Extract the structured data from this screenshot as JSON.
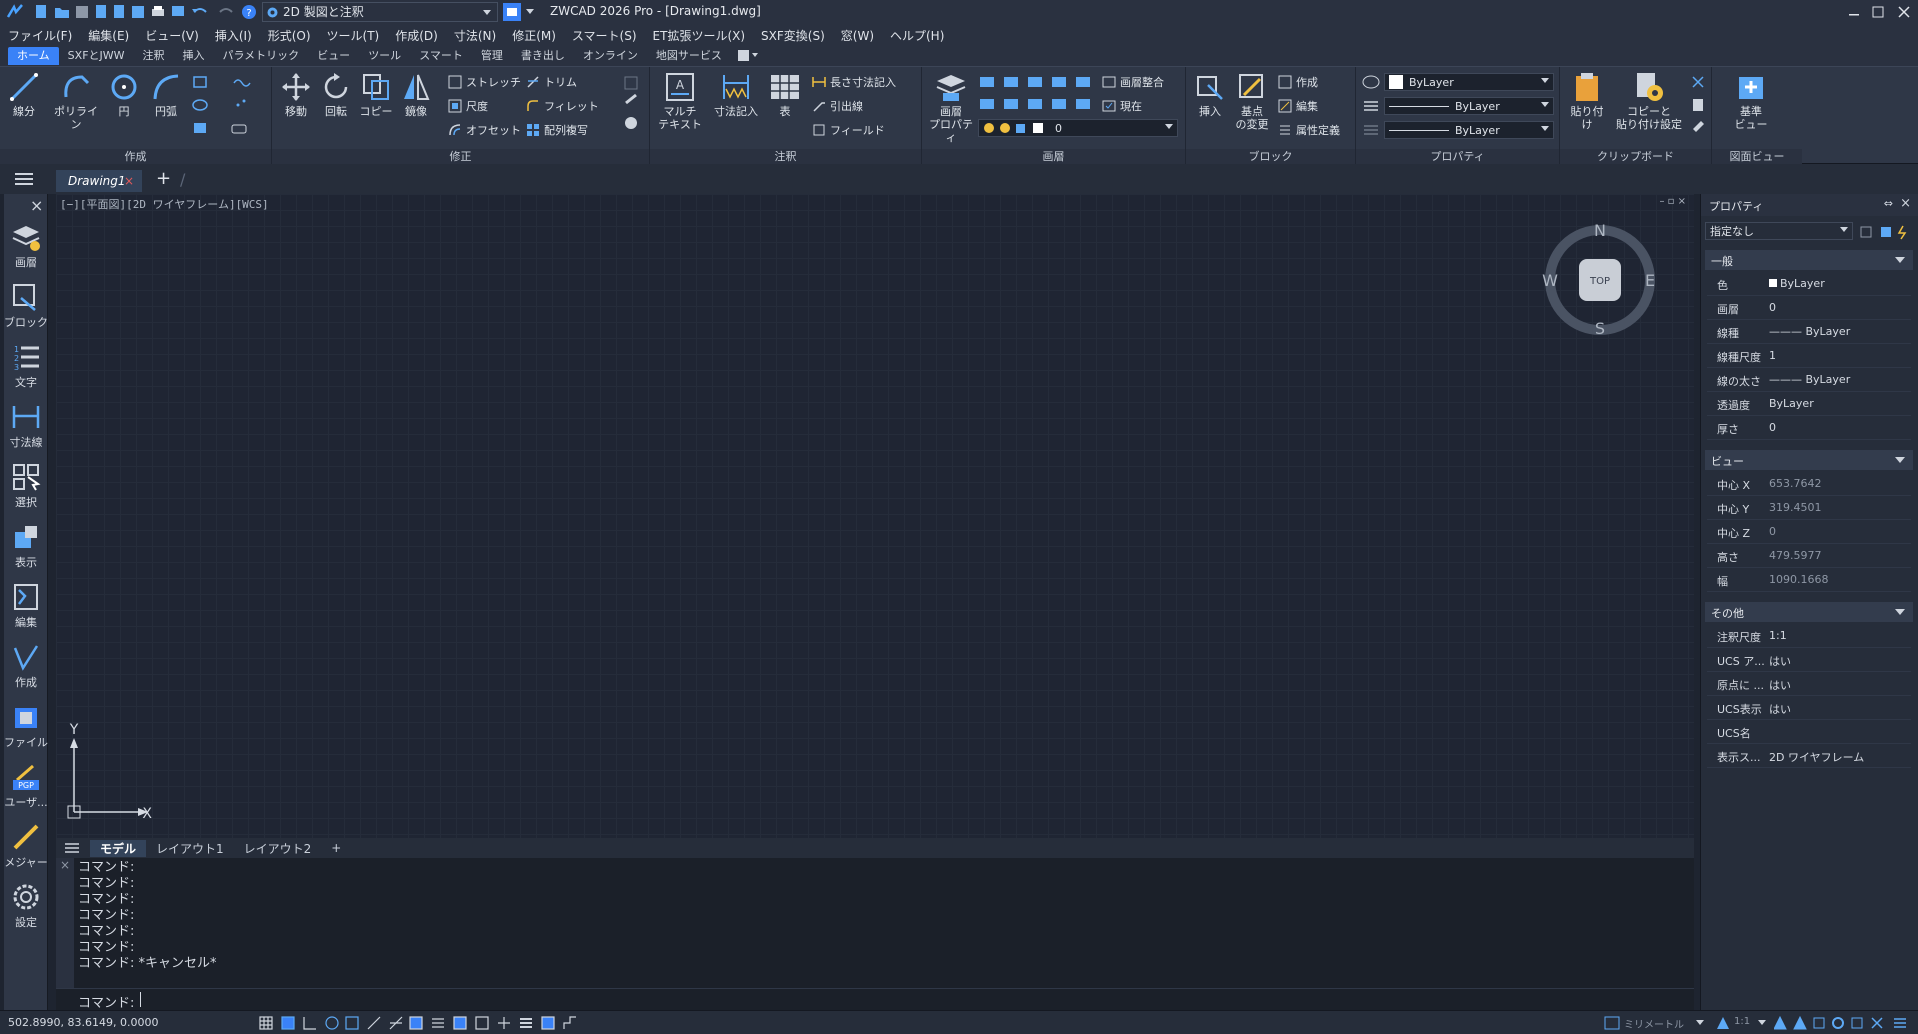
{
  "titlebar": {
    "workspace": "2D 製図と注釈",
    "title": "ZWCAD 2026 Pro - [Drawing1.dwg]"
  },
  "menu": [
    "ファイル(F)",
    "編集(E)",
    "ビュー(V)",
    "挿入(I)",
    "形式(O)",
    "ツール(T)",
    "作成(D)",
    "寸法(N)",
    "修正(M)",
    "スマート(S)",
    "ET拡張ツール(X)",
    "SXF変換(S)",
    "窓(W)",
    "ヘルプ(H)"
  ],
  "ribbon_tabs": [
    "ホーム",
    "SXFとJWW",
    "注釈",
    "挿入",
    "パラメトリック",
    "ビュー",
    "ツール",
    "スマート",
    "管理",
    "書き出し",
    "オンライン",
    "地図サービス"
  ],
  "ribbon": {
    "create": {
      "label": "作成",
      "line": "線分",
      "polyline": "ポリライン",
      "circle": "円",
      "arc": "円弧"
    },
    "modify": {
      "label": "修正",
      "move": "移動",
      "rotate": "回転",
      "copy": "コピー",
      "mirror": "鏡像",
      "stretch": "ストレッチ",
      "scale": "尺度",
      "offset": "オフセット",
      "trim": "トリム",
      "fillet": "フィレット",
      "array": "配列複写"
    },
    "annotation": {
      "label": "注釈",
      "mtext_1": "マルチ",
      "mtext_2": "テキスト",
      "dim": "寸法記入",
      "table": "表",
      "lendim": "長さ寸法記入",
      "leader": "引出線",
      "field": "フィールド"
    },
    "layer": {
      "label": "画層",
      "props_1": "画層",
      "props_2": "プロパティ",
      "match": "画層整合",
      "current": "現在",
      "combo": "0"
    },
    "block": {
      "label": "ブロック",
      "insert": "挿入",
      "base_1": "基点",
      "base_2": "の変更",
      "create": "作成",
      "edit": "編集",
      "attr": "属性定義"
    },
    "properties": {
      "label": "プロパティ",
      "color": "ByLayer",
      "linetype": "ByLayer",
      "lineweight": "ByLayer"
    },
    "clipboard": {
      "label": "クリップボード",
      "paste": "貼り付け",
      "copyset_1": "コピーと",
      "copyset_2": "貼り付け設定"
    },
    "view": {
      "label": "図面ビュー",
      "base_1": "基準",
      "base_2": "ビュー"
    }
  },
  "doc_tab": "Drawing1",
  "left_toolbar": [
    "画層",
    "ブロック",
    "文字",
    "寸法線",
    "選択",
    "表示",
    "編集",
    "作成",
    "ファイル",
    "ユーザ...",
    "メジャー",
    "設定"
  ],
  "viewport_label": "[−][平面図][2D ワイヤフレーム][WCS]",
  "viewcube": {
    "top": "TOP",
    "n": "N",
    "s": "S",
    "e": "E",
    "w": "W"
  },
  "ucs": {
    "x": "X",
    "y": "Y"
  },
  "layout_tabs": [
    "モデル",
    "レイアウト1",
    "レイアウト2"
  ],
  "command_history": [
    "コマンド:",
    "コマンド:",
    "コマンド:",
    "コマンド:",
    "コマンド:",
    "コマンド:",
    "コマンド: *キャンセル*"
  ],
  "command_prompt": "コマンド:",
  "status": {
    "coords": "502.8990, 83.6149, 0.0000",
    "units": "ミリメートル",
    "scale": "1:1"
  },
  "properties": {
    "title": "プロパティ",
    "selection": "指定なし",
    "general": {
      "label": "一般",
      "rows": [
        {
          "k": "色",
          "v": "ByLayer"
        },
        {
          "k": "画層",
          "v": "0"
        },
        {
          "k": "線種",
          "v": "——— ByLayer"
        },
        {
          "k": "線種尺度",
          "v": "1"
        },
        {
          "k": "線の太さ",
          "v": "——— ByLayer"
        },
        {
          "k": "透過度",
          "v": "ByLayer"
        },
        {
          "k": "厚さ",
          "v": "0"
        }
      ]
    },
    "view": {
      "label": "ビュー",
      "rows": [
        {
          "k": "中心 X",
          "v": "653.7642"
        },
        {
          "k": "中心 Y",
          "v": "319.4501"
        },
        {
          "k": "中心 Z",
          "v": "0"
        },
        {
          "k": "高さ",
          "v": "479.5977"
        },
        {
          "k": "幅",
          "v": "1090.1668"
        }
      ]
    },
    "misc": {
      "label": "その他",
      "rows": [
        {
          "k": "注釈尺度",
          "v": "1:1"
        },
        {
          "k": "UCS ア...",
          "v": "はい"
        },
        {
          "k": "原点に ...",
          "v": "はい"
        },
        {
          "k": "UCS表示",
          "v": "はい"
        },
        {
          "k": "UCS名",
          "v": ""
        },
        {
          "k": "表示ス...",
          "v": "2D ワイヤフレーム"
        }
      ]
    }
  },
  "colors": {
    "accent": "#3a82f7",
    "canvas": "#1f2533",
    "panel": "#2f3747"
  }
}
